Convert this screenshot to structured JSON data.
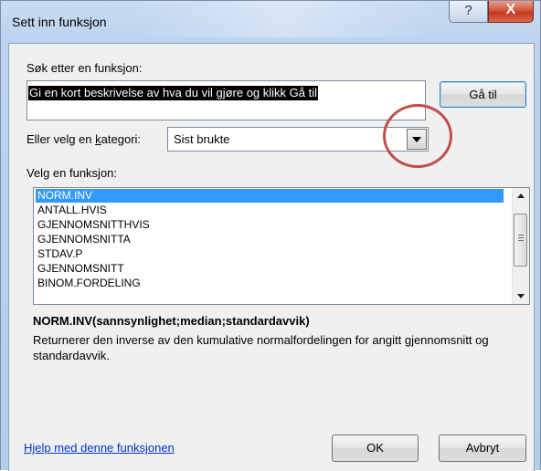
{
  "window": {
    "title": "Sett inn funksjon",
    "help_glyph": "?",
    "close_glyph": "X"
  },
  "search": {
    "label": "Søk etter en funksjon:",
    "value": "Gi en kort beskrivelse av hva du vil gjøre og klikk Gå til",
    "goto_label": "Gå til"
  },
  "category": {
    "label_prefix": "Eller velg en ",
    "label_underlined": "k",
    "label_suffix": "ategori:",
    "selected": "Sist brukte"
  },
  "functions": {
    "label": "Velg en funksjon:",
    "items": [
      "NORM.INV",
      "ANTALL.HVIS",
      "GJENNOMSNITTHVIS",
      "GJENNOMSNITTA",
      "STDAV.P",
      "GJENNOMSNITT",
      "BINOM.FORDELING"
    ],
    "selected_index": 0
  },
  "details": {
    "syntax": "NORM.INV(sannsynlighet;median;standardavvik)",
    "description": "Returnerer den inverse av den kumulative normalfordelingen for angitt gjennomsnitt og standardavvik."
  },
  "footer": {
    "help_link": "Hjelp med denne funksjonen",
    "ok_label": "OK",
    "cancel_label": "Avbryt"
  },
  "colors": {
    "selection": "#3399ff",
    "annotation_circle": "#c0504d",
    "link": "#0033cc"
  }
}
